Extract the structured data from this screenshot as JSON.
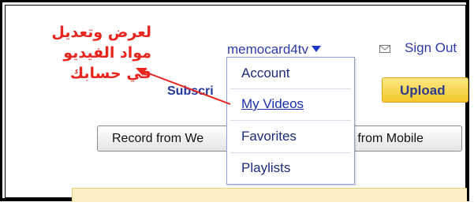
{
  "annotation": {
    "lines": [
      "لعرض وتعديل",
      "مواد الفيديو",
      "في حسابك"
    ],
    "color": "#e8251f"
  },
  "header": {
    "username": "memocard4tv",
    "dropdown_icon": "triangle-down-icon",
    "mail_icon": "envelope-icon",
    "sign_out": "Sign Out"
  },
  "nav": {
    "subscriptions_partial": "Subscri",
    "upload": "Upload"
  },
  "account_menu": {
    "items": [
      {
        "label": "Account"
      },
      {
        "label": "My Videos"
      },
      {
        "label": "Favorites"
      },
      {
        "label": "Playlists"
      }
    ]
  },
  "record": {
    "left_partial": "Record from We",
    "right_partial": "d from Mobile"
  },
  "colors": {
    "link": "#2e3ba8",
    "upload_bg": "#f5c82c",
    "menu_border": "#8ea5d8"
  }
}
